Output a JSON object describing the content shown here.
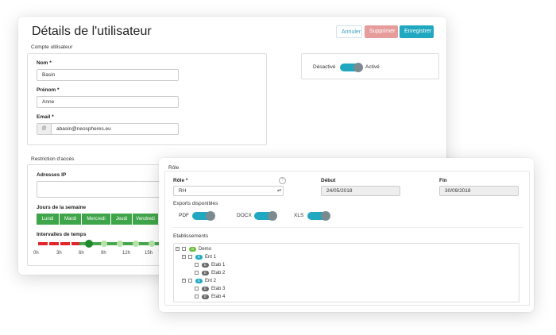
{
  "user_card": {
    "title": "Détails de l'utilisateur",
    "buttons": {
      "cancel": "Annuler",
      "delete": "Supprimer",
      "save": "Enregistrer"
    },
    "account_section": "Compte utilisateur",
    "fields": {
      "nom_label": "Nom *",
      "nom_value": "Basin",
      "prenom_label": "Prénom *",
      "prenom_value": "Anne",
      "email_label": "Email *",
      "email_value": "abasin@neospheres.eu"
    },
    "status": {
      "off_label": "Désactivé",
      "on_label": "Activé",
      "active": true
    },
    "access_section": "Restriction d'accès",
    "ip_label": "Adresses IP",
    "days_label": "Jours de la semaine",
    "days": [
      "Lundi",
      "Mardi",
      "Mercredi",
      "Jeudi",
      "Vendredi"
    ],
    "timeline_label": "Intervalles de temps",
    "timeline_ticks": [
      "0h",
      "3h",
      "6h",
      "9h",
      "12h",
      "15h"
    ]
  },
  "role_card": {
    "title": "Rôle",
    "role_label": "Rôle *",
    "role_value": "RH",
    "start_label": "Début",
    "start_value": "24/05/2018",
    "end_label": "Fin",
    "end_value": "30/09/2018",
    "exports_label": "Exports disponibles",
    "exports": [
      {
        "label": "PDF",
        "enabled": true
      },
      {
        "label": "DOCX",
        "enabled": true
      },
      {
        "label": "XLS",
        "enabled": true
      }
    ],
    "establishments_label": "Etablissements",
    "tree": {
      "root": "Demo",
      "ent1": "Ent 1",
      "ent1_children": [
        "Etab 1",
        "Etab 2"
      ],
      "ent2": "Ent 2",
      "ent2_children": [
        "Etab 3",
        "Etab 4"
      ]
    },
    "colors": {
      "accent": "#1fa8c0",
      "green": "#3fa54a",
      "red": "#e0262a"
    }
  }
}
